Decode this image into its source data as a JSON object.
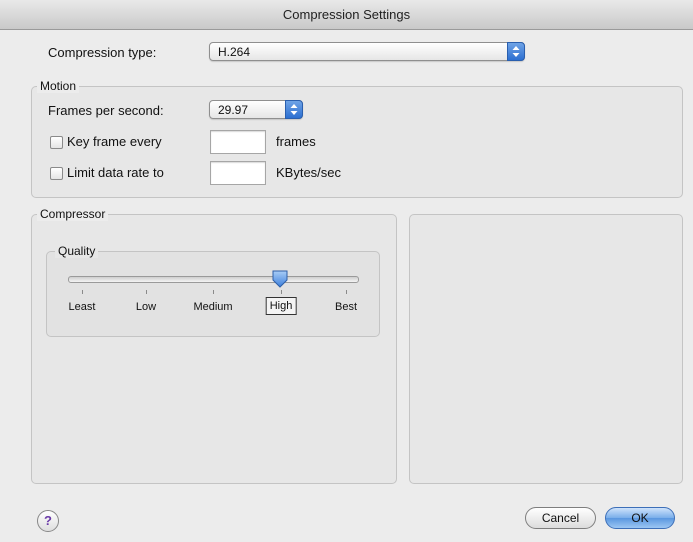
{
  "window": {
    "title": "Compression Settings"
  },
  "compression": {
    "type_label": "Compression type:",
    "type_value": "H.264"
  },
  "motion": {
    "group_title": "Motion",
    "fps_label": "Frames per second:",
    "fps_value": "29.97",
    "keyframe_label": "Key frame every",
    "keyframe_value": "",
    "keyframe_unit": "frames",
    "datarate_label": "Limit data rate to",
    "datarate_value": "",
    "datarate_unit": "KBytes/sec"
  },
  "compressor": {
    "group_title": "Compressor",
    "quality_title": "Quality",
    "quality_labels": [
      "Least",
      "Low",
      "Medium",
      "High",
      "Best"
    ],
    "quality_selected": "High",
    "quality_level": 0.75
  },
  "buttons": {
    "help": "?",
    "cancel": "Cancel",
    "ok": "OK"
  },
  "colors": {
    "accent": "#2c6fd1",
    "help_glyph": "#6a3aa8"
  }
}
